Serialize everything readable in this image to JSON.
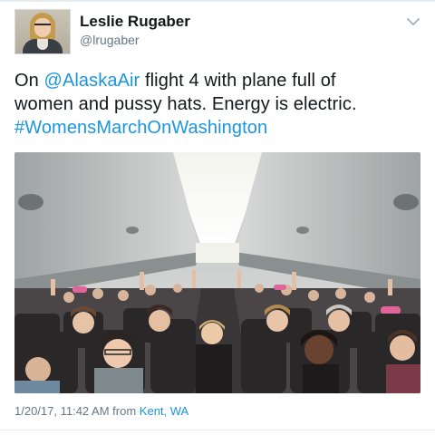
{
  "author": {
    "name": "Leslie Rugaber",
    "handle": "@lrugaber",
    "avatar_icon": "profile-photo-avatar"
  },
  "menu": {
    "icon": "chevron-down-icon"
  },
  "tweet": {
    "line1_prefix": "On ",
    "mention": "@AlaskaAir",
    "line1_suffix": " flight 4 with plane full of",
    "line2": "women and pussy hats. Energy is electric.",
    "hashtag": "#WomensMarchOnWashington"
  },
  "photo": {
    "description_icon": "airplane-cabin-photo"
  },
  "footer": {
    "timestamp": "1/20/17, 11:42 AM from",
    "location": "Kent, WA"
  },
  "colors": {
    "link": "#1b95e0",
    "secondary": "#657786",
    "text": "#14171a",
    "hat_pink": "#e0659a"
  }
}
